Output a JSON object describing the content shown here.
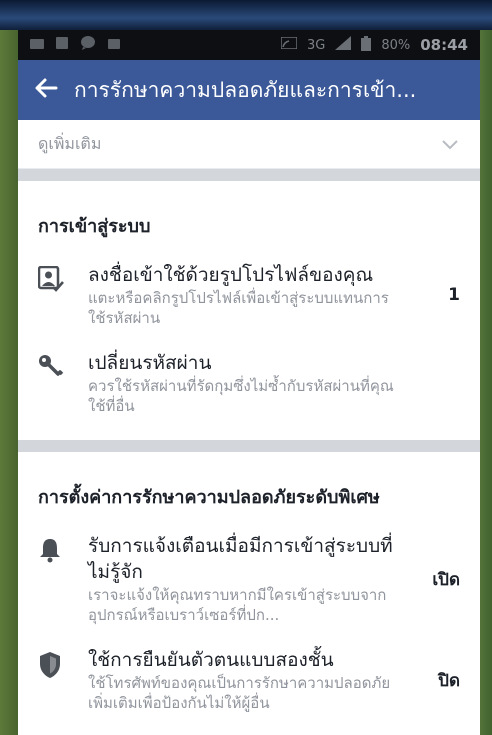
{
  "status_bar": {
    "network": "3G",
    "battery": "80%",
    "time": "08:44"
  },
  "app_bar": {
    "title": "การรักษาความปลอดภัยและการเข้า..."
  },
  "see_more": {
    "label": "ดูเพิ่มเติม"
  },
  "sections": [
    {
      "title": "การเข้าสู่ระบบ",
      "items": [
        {
          "icon": "profile-login-icon",
          "title": "ลงชื่อเข้าใช้ด้วยรูปโปรไฟล์ของคุณ",
          "subtitle": "แตะหรือคลิกรูปโปรไฟล์เพื่อเข้าสู่ระบบแทนการใช้รหัสผ่าน",
          "value": "1"
        },
        {
          "icon": "key-icon",
          "title": "เปลี่ยนรหัสผ่าน",
          "subtitle": "ควรใช้รหัสผ่านที่รัดกุมซึ่งไม่ซ้ำกับรหัสผ่านที่คุณใช้ที่อื่น",
          "value": ""
        }
      ]
    },
    {
      "title": "การตั้งค่าการรักษาความปลอดภัยระดับพิเศษ",
      "items": [
        {
          "icon": "bell-icon",
          "title": "รับการแจ้งเตือนเมื่อมีการเข้าสู่ระบบที่ไม่รู้จัก",
          "subtitle": "เราจะแจ้งให้คุณทราบหากมีใครเข้าสู่ระบบจากอุปกรณ์หรือเบราว์เซอร์ที่ปก...",
          "value": "เปิด"
        },
        {
          "icon": "shield-icon",
          "title": "ใช้การยืนยันตัวตนแบบสองชั้น",
          "subtitle": "ใช้โทรศัพท์ของคุณเป็นการรักษาความปลอดภัยเพิ่มเติมเพื่อป้องกันไม่ให้ผู้อื่น",
          "value": "ปิด"
        }
      ]
    }
  ],
  "colors": {
    "app_bar": "#3b5998",
    "status_bar": "#0d0f12",
    "separator": "#d3d6db",
    "primary_text": "#1d2129",
    "secondary_text": "#90949c"
  }
}
